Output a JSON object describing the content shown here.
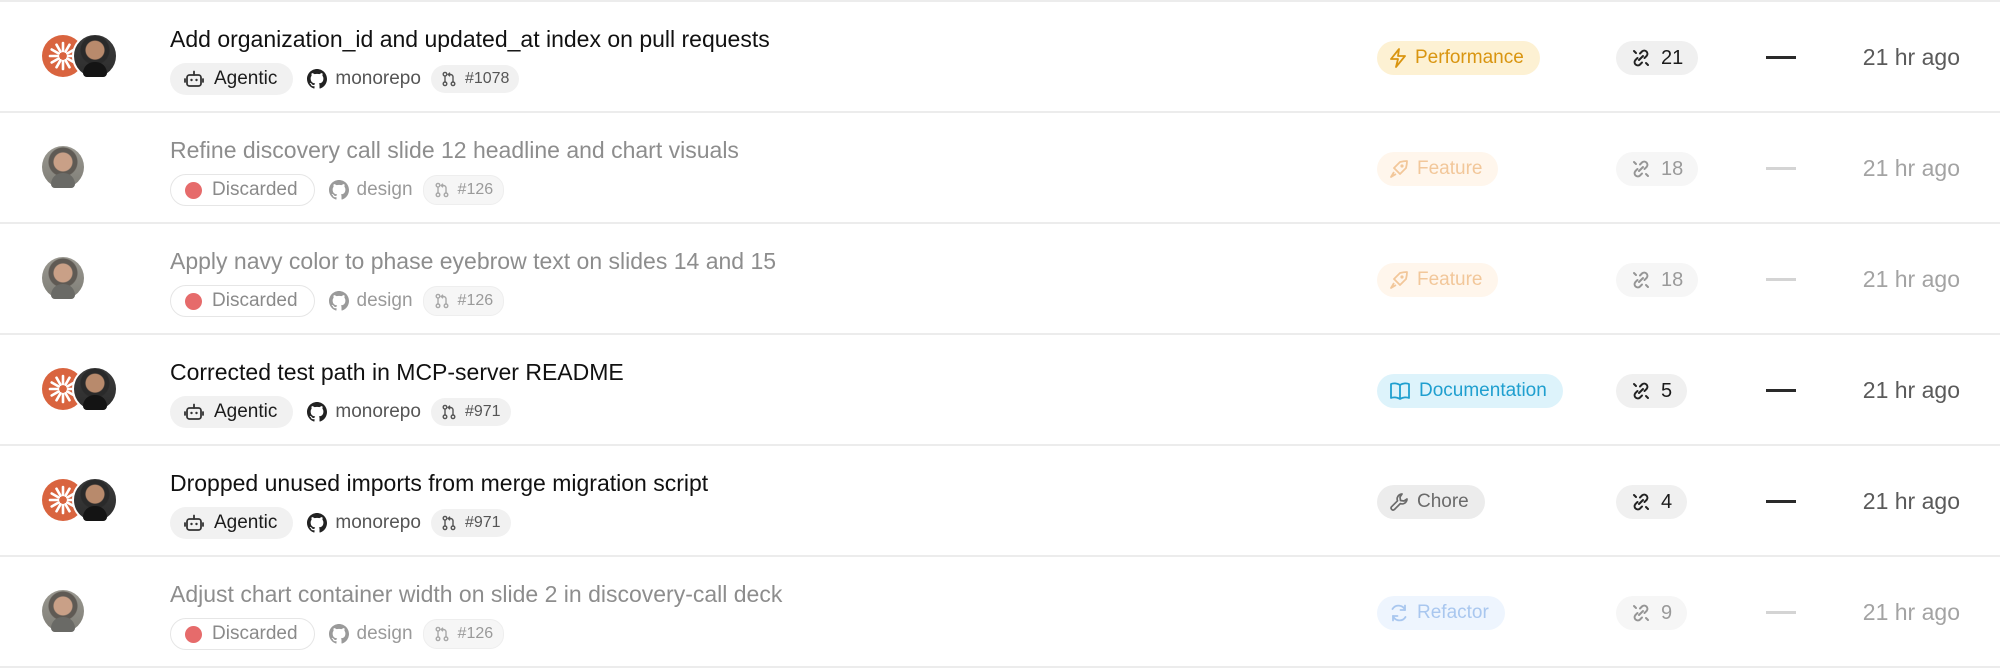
{
  "rows": [
    {
      "title": "Add organization_id and updated_at index on pull requests",
      "status": "Agentic",
      "status_kind": "agentic",
      "repo": "monorepo",
      "pr": "#1078",
      "type": "Performance",
      "type_icon": "lightning-icon",
      "type_bg": "#fdf1d3",
      "type_fg": "#d99510",
      "count": "21",
      "time": "21 hr ago",
      "dimmed": false,
      "avatars": [
        "agent-avatar",
        "user-avatar"
      ]
    },
    {
      "title": "Refine discovery call slide 12 headline and chart visuals",
      "status": "Discarded",
      "status_kind": "discarded",
      "repo": "design",
      "pr": "#126",
      "type": "Feature",
      "type_icon": "rocket-icon",
      "type_bg": "#fff6ec",
      "type_fg": "#f2c79a",
      "count": "18",
      "time": "21 hr ago",
      "dimmed": true,
      "avatars": [
        "user-avatar"
      ]
    },
    {
      "title": "Apply navy color to phase eyebrow text on slides 14 and 15",
      "status": "Discarded",
      "status_kind": "discarded",
      "repo": "design",
      "pr": "#126",
      "type": "Feature",
      "type_icon": "rocket-icon",
      "type_bg": "#fff6ec",
      "type_fg": "#f2c79a",
      "count": "18",
      "time": "21 hr ago",
      "dimmed": true,
      "avatars": [
        "user-avatar"
      ]
    },
    {
      "title": "Corrected test path in MCP-server README",
      "status": "Agentic",
      "status_kind": "agentic",
      "repo": "monorepo",
      "pr": "#971",
      "type": "Documentation",
      "type_icon": "book-icon",
      "type_bg": "#ddf3fb",
      "type_fg": "#1f9fcf",
      "count": "5",
      "time": "21 hr ago",
      "dimmed": false,
      "avatars": [
        "agent-avatar",
        "user-avatar"
      ]
    },
    {
      "title": "Dropped unused imports from merge migration script",
      "status": "Agentic",
      "status_kind": "agentic",
      "repo": "monorepo",
      "pr": "#971",
      "type": "Chore",
      "type_icon": "wrench-icon",
      "type_bg": "#ececec",
      "type_fg": "#6a6a6a",
      "count": "4",
      "time": "21 hr ago",
      "dimmed": false,
      "avatars": [
        "agent-avatar",
        "user-avatar"
      ]
    },
    {
      "title": "Adjust chart container width on slide 2 in discovery-call deck",
      "status": "Discarded",
      "status_kind": "discarded",
      "repo": "design",
      "pr": "#126",
      "type": "Refactor",
      "type_icon": "refresh-icon",
      "type_bg": "#eef5fe",
      "type_fg": "#a9c7ef",
      "count": "9",
      "time": "21 hr ago",
      "dimmed": true,
      "avatars": [
        "user-avatar"
      ]
    }
  ]
}
